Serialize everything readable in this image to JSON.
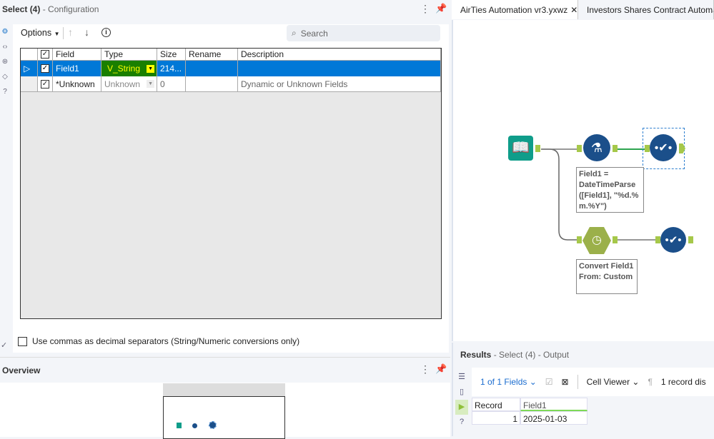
{
  "config": {
    "title": "Select (4)",
    "subtitle": "- Configuration",
    "options_label": "Options",
    "search_placeholder": "Search",
    "columns": [
      "Field",
      "Type",
      "Size",
      "Rename",
      "Description"
    ],
    "rows": [
      {
        "field": "Field1",
        "type": "V_String",
        "size": "214...",
        "rename": "",
        "description": ""
      },
      {
        "field": "*Unknown",
        "type": "Unknown",
        "size": "0",
        "rename": "",
        "description": "Dynamic or Unknown Fields"
      }
    ],
    "commas_label": "Use commas as decimal separators (String/Numeric conversions only)"
  },
  "overview": {
    "title": "Overview"
  },
  "tabs": [
    {
      "label": "AirTies Automation vr3.yxwz"
    },
    {
      "label": "Investors Shares Contract Automation"
    }
  ],
  "canvas": {
    "formula_note": "Field1 = DateTimeParse ([Field1], \"%d.% m.%Y\")",
    "datetime_note": "Convert Field1 From: Custom"
  },
  "results": {
    "title": "Results",
    "subtitle": "- Select (4) - Output",
    "fields_label": "1 of 1 Fields",
    "cell_viewer": "Cell Viewer",
    "record_info": "1 record dis",
    "columns": [
      "Record",
      "Field1"
    ],
    "rows": [
      {
        "record": "1",
        "field1": "2025-01-03"
      }
    ]
  },
  "colors": {
    "selected_row": "#0078d7",
    "highlight": "#1a7f00",
    "accent": "#a6c84a"
  }
}
